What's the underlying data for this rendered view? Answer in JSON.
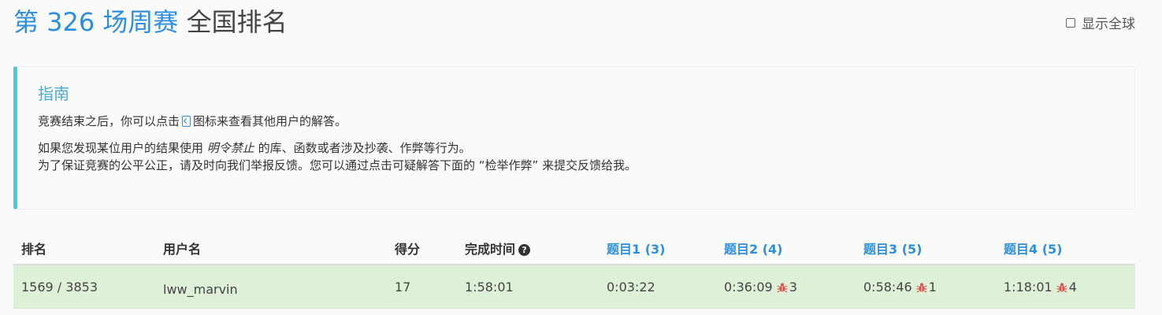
{
  "header": {
    "contest_title": "第 326 场周赛",
    "page_title": "全国排名",
    "global_toggle_label": "显示全球"
  },
  "guide": {
    "title": "指南",
    "line1_before": "竞赛结束之后，你可以点击",
    "line1_after": "图标来查看其他用户的解答。",
    "line2_before": "如果您发现某位用户的结果使用",
    "line2_emphasis": "明令禁止",
    "line2_after": "的库、函数或者涉及抄袭、作弊等行为。",
    "line3": "为了保证竞赛的公平公正，请及时向我们举报反馈。您可以通过点击可疑解答下面的 “检举作弊” 来提交反馈给我。"
  },
  "table": {
    "headers": {
      "rank": "排名",
      "username": "用户名",
      "score": "得分",
      "finish_time": "完成时间",
      "q1": "题目1 (3)",
      "q2": "题目2 (4)",
      "q3": "题目3 (5)",
      "q4": "题目4 (5)"
    },
    "rows": [
      {
        "rank": "1569 / 3853",
        "username": "lww_marvin",
        "score": "17",
        "finish_time": "1:58:01",
        "q1_time": "0:03:22",
        "q2_time": "0:36:09",
        "q2_bugs": "3",
        "q3_time": "0:58:46",
        "q3_bugs": "1",
        "q4_time": "1:18:01",
        "q4_bugs": "4"
      }
    ]
  },
  "colors": {
    "accent": "#2d8fe0",
    "guide_border": "#5bc0de",
    "row_success": "#dff0d8",
    "bug": "#d9534f"
  },
  "icons": {
    "help": "question-circle-icon",
    "bug": "bug-icon",
    "code": "code-file-icon"
  }
}
